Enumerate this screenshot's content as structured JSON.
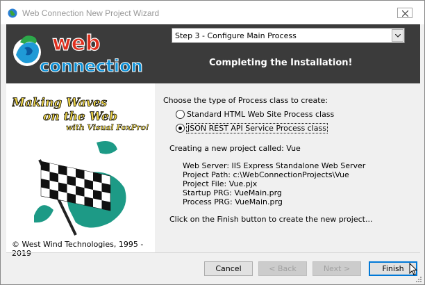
{
  "window": {
    "title": "Web Connection New Project Wizard"
  },
  "banner": {
    "logo_text_top": "web",
    "logo_text_bottom": "connection",
    "step_select_value": "Step 3 - Configure Main Process",
    "heading": "Completing the Installation!"
  },
  "left_panel": {
    "tagline_line1": "Making Waves",
    "tagline_line2": "on the Web",
    "tagline_line3": "with Visual FoxPro!",
    "copyright": "© West Wind Technologies, 1995 - 2019"
  },
  "main": {
    "prompt": "Choose the type of Process class to create:",
    "options": [
      {
        "label": "Standard HTML Web Site Process class",
        "selected": false
      },
      {
        "label": "JSON REST API Service Process class",
        "selected": true
      }
    ],
    "creating_line": "Creating a new project called: Vue",
    "details": [
      "Web Server: IIS Express Standalone Web Server",
      "Project Path: c:\\WebConnectionProjects\\Vue",
      "Project File: Vue.pjx",
      "Startup PRG: VueMain.prg",
      "Process PRG: VueMain.prg"
    ],
    "finish_hint": "Click on the Finish button to create the new project..."
  },
  "buttons": {
    "cancel": "Cancel",
    "back": "< Back",
    "next": "Next >",
    "finish": "Finish"
  },
  "icons": {
    "app": "globe-icon",
    "close": "close-icon",
    "dropdown": "chevron-down-icon"
  },
  "colors": {
    "banner_bg": "#3b3b3b",
    "accent": "#0078d7",
    "logo_red": "#e0301e",
    "logo_blue": "#0a8fd6"
  }
}
